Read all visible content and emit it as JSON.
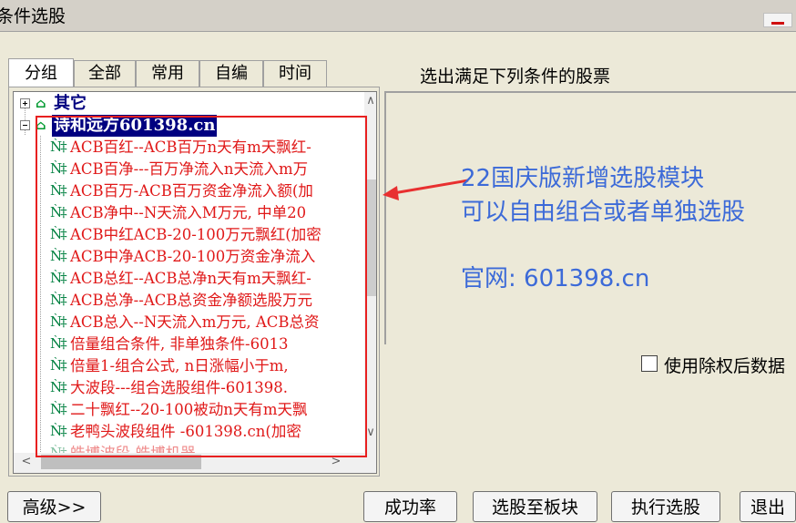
{
  "window": {
    "title": "条件选股"
  },
  "tabs": [
    "分组",
    "全部",
    "常用",
    "自编",
    "时间"
  ],
  "tree": {
    "group_other": "其它",
    "group_selected": "诗和远方601398.cn",
    "items": [
      "ACB百红--ACB百万n天有m天飘红-",
      "ACB百净---百万净流入n天流入m万",
      "ACB百万-ACB百万资金净流入额(加",
      "ACB净中--N天流入M万元, 中单20",
      "ACB中红ACB-20-100万元飘红(加密",
      "ACB中净ACB-20-100万资金净流入",
      "ACB总红--ACB总净n天有m天飘红-",
      "ACB总净--ACB总资金净额选股万元",
      "ACB总入--N天流入m万元, ACB总资",
      "倍量组合条件, 非单独条件-6013",
      "倍量1-组合公式, n日涨幅小于m,",
      "大波段---组合选股组件-601398.",
      "二十飘红--20-100被动n天有m天飘",
      "老鸭头波段组件 -601398.cn(加密",
      "皓博波段-皓博机器..."
    ]
  },
  "condition_label": "选出满足下列条件的股票",
  "overlay": {
    "line1": "22国庆版新增选股模块",
    "line2": "可以自由组合或者单独选股",
    "line3": "官网: 601398.cn"
  },
  "checkbox_label": "使用除权后数据",
  "buttons": {
    "advanced": "高级>>",
    "success_rate": "成功率",
    "to_block": "选股至板块",
    "execute": "执行选股",
    "exit": "退出"
  },
  "icons": {
    "group": "house-icon",
    "formula": "binoculars-icon"
  }
}
